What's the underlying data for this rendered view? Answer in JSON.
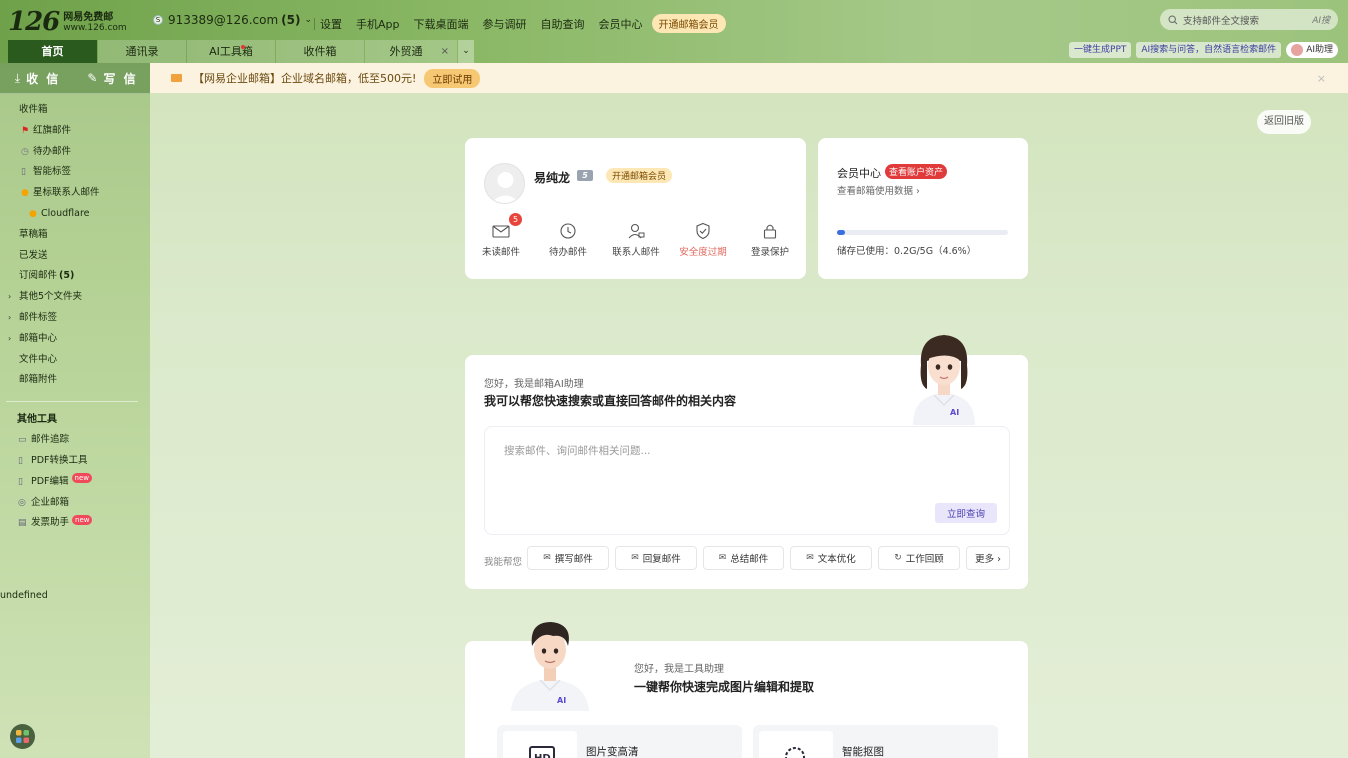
{
  "header": {
    "logo": {
      "number": "126",
      "title": "网易免费邮",
      "domain": "www.126.com"
    },
    "account": {
      "email": "913389@126.com",
      "count": "(5)"
    },
    "nav": [
      "设置",
      "手机App",
      "下载桌面端",
      "参与调研",
      "自助查询",
      "会员中心"
    ],
    "vip_button": "开通邮箱会员",
    "search": {
      "placeholder": "支持邮件全文搜索",
      "ai_label": "AI搜"
    }
  },
  "tabs": [
    {
      "label": "首页",
      "active": true
    },
    {
      "label": "通讯录"
    },
    {
      "label": "AI工具箱"
    },
    {
      "label": "收件箱"
    },
    {
      "label": "外贸通"
    }
  ],
  "right_buttons": {
    "ppt": "一键生成PPT",
    "ai_search": "AI搜索与问答，自然语言检索邮件",
    "assistant": "AI助理"
  },
  "sidebar": {
    "receive": "收 信",
    "compose": "写 信",
    "folders": [
      {
        "label": "收件箱"
      },
      {
        "label": "红旗邮件",
        "sub": true,
        "icon": "flag-icon"
      },
      {
        "label": "待办邮件",
        "sub": true,
        "icon": "clock-icon"
      },
      {
        "label": "智能标签",
        "sub": true,
        "icon": "tag-icon"
      },
      {
        "label": "星标联系人邮件",
        "sub": true,
        "icon": "star-icon"
      },
      {
        "label": "Cloudflare",
        "sub": true,
        "indent": true,
        "icon": "star-icon"
      },
      {
        "label": "草稿箱"
      },
      {
        "label": "已发送"
      },
      {
        "label": "订阅邮件",
        "badge": "(5)"
      },
      {
        "label": "其他5个文件夹",
        "arrow": true
      },
      {
        "label": "邮件标签",
        "arrow": true
      },
      {
        "label": "邮箱中心",
        "arrow": true
      },
      {
        "label": "文件中心"
      },
      {
        "label": "邮箱附件"
      }
    ],
    "tools_title": "其他工具",
    "tools": [
      {
        "label": "邮件追踪",
        "icon": "tracking-icon"
      },
      {
        "label": "PDF转换工具",
        "icon": "pdf-icon"
      },
      {
        "label": "PDF编辑",
        "icon": "pdf-edit-icon",
        "new": "new"
      },
      {
        "label": "企业邮箱",
        "icon": "globe-icon"
      },
      {
        "label": "发票助手",
        "icon": "invoice-icon",
        "new": "new"
      }
    ],
    "undefined_text": "undefined"
  },
  "banner": {
    "text": "【网易企业邮箱】企业域名邮箱，低至500元!",
    "button": "立即试用",
    "close": "×"
  },
  "old_version": "返回旧版",
  "profile": {
    "name": "易纯龙",
    "level": "5",
    "vip": "开通邮箱会员",
    "actions": [
      {
        "label": "未读邮件",
        "count": "5"
      },
      {
        "label": "待办邮件"
      },
      {
        "label": "联系人邮件"
      },
      {
        "label": "安全度过期",
        "warn": true
      },
      {
        "label": "登录保护"
      }
    ]
  },
  "member": {
    "title": "会员中心",
    "tag": "查看账户资产",
    "link": "查看邮箱使用数据 ›",
    "storage_text": "储存已使用：0.2G/5G（4.6%）",
    "storage_percent": 4.6
  },
  "ai_assistant": {
    "greeting": "您好，我是邮箱AI助理",
    "headline": "我可以帮您快速搜索或直接回答邮件的相关内容",
    "placeholder": "搜索邮件、询问邮件相关问题...",
    "submit": "立即查询",
    "help_label": "我能帮您",
    "chips": [
      "撰写邮件",
      "回复邮件",
      "总结邮件",
      "文本优化",
      "工作回顾",
      "更多 ›"
    ],
    "badge": "AI"
  },
  "tool_assistant": {
    "greeting": "您好，我是工具助理",
    "headline": "一键帮你快速完成图片编辑和提取",
    "cards": [
      "图片变高清",
      "智能抠图"
    ],
    "hd_label": "HD",
    "badge": "AI"
  },
  "colors": {
    "accent": "#2b5a1f",
    "warn": "#e2685e",
    "badge_red": "#e8453c",
    "progress": "#3a6fe0"
  }
}
